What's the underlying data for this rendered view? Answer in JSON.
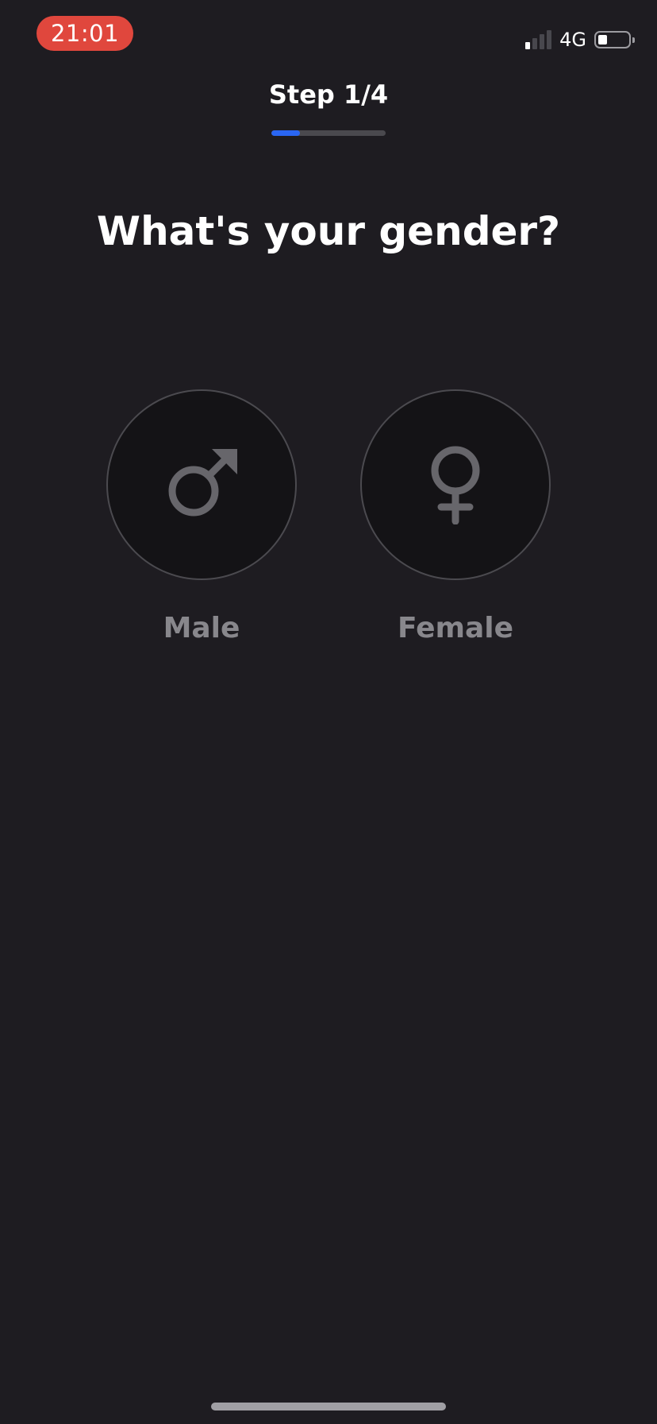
{
  "status_bar": {
    "time": "21:01",
    "network": "4G",
    "signal_bars_active": 1,
    "signal_bars_total": 4,
    "battery_level": 0.25,
    "time_pill_color": "#e0473d"
  },
  "header": {
    "step_label": "Step 1/4",
    "progress": 0.25,
    "progress_color": "#2a66f3"
  },
  "question": "What's your gender?",
  "options": [
    {
      "label": "Male",
      "icon": "male-symbol-icon"
    },
    {
      "label": "Female",
      "icon": "female-symbol-icon"
    }
  ]
}
